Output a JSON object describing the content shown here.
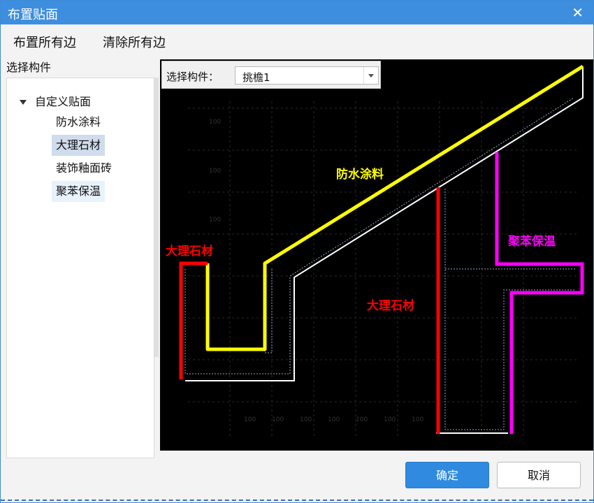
{
  "window": {
    "title": "布置贴面"
  },
  "menu": {
    "place_all": "布置所有边",
    "clear_all": "清除所有边"
  },
  "left_pane": {
    "label": "选择构件",
    "tree_root": "自定义贴面",
    "items": [
      {
        "label": "防水涂料"
      },
      {
        "label": "大理石材"
      },
      {
        "label": "装饰釉面砖"
      },
      {
        "label": "聚苯保温"
      }
    ]
  },
  "component_picker": {
    "label": "选择构件：",
    "value": "挑檐1"
  },
  "drawing": {
    "labels": {
      "waterproof": "防水涂料",
      "marble_left": "大理石材",
      "marble_right": "大理石材",
      "insulation": "聚苯保温"
    },
    "colors": {
      "waterproof": "#ffff00",
      "marble": "#ff0000",
      "insulation": "#ff00ff",
      "background": "#000000",
      "structure": "#ffffff"
    },
    "dimension_text": "100"
  },
  "buttons": {
    "ok": "确定",
    "cancel": "取消"
  },
  "colors": {
    "accent": "#3e8ee0",
    "selected_item": "#cfdcec"
  }
}
